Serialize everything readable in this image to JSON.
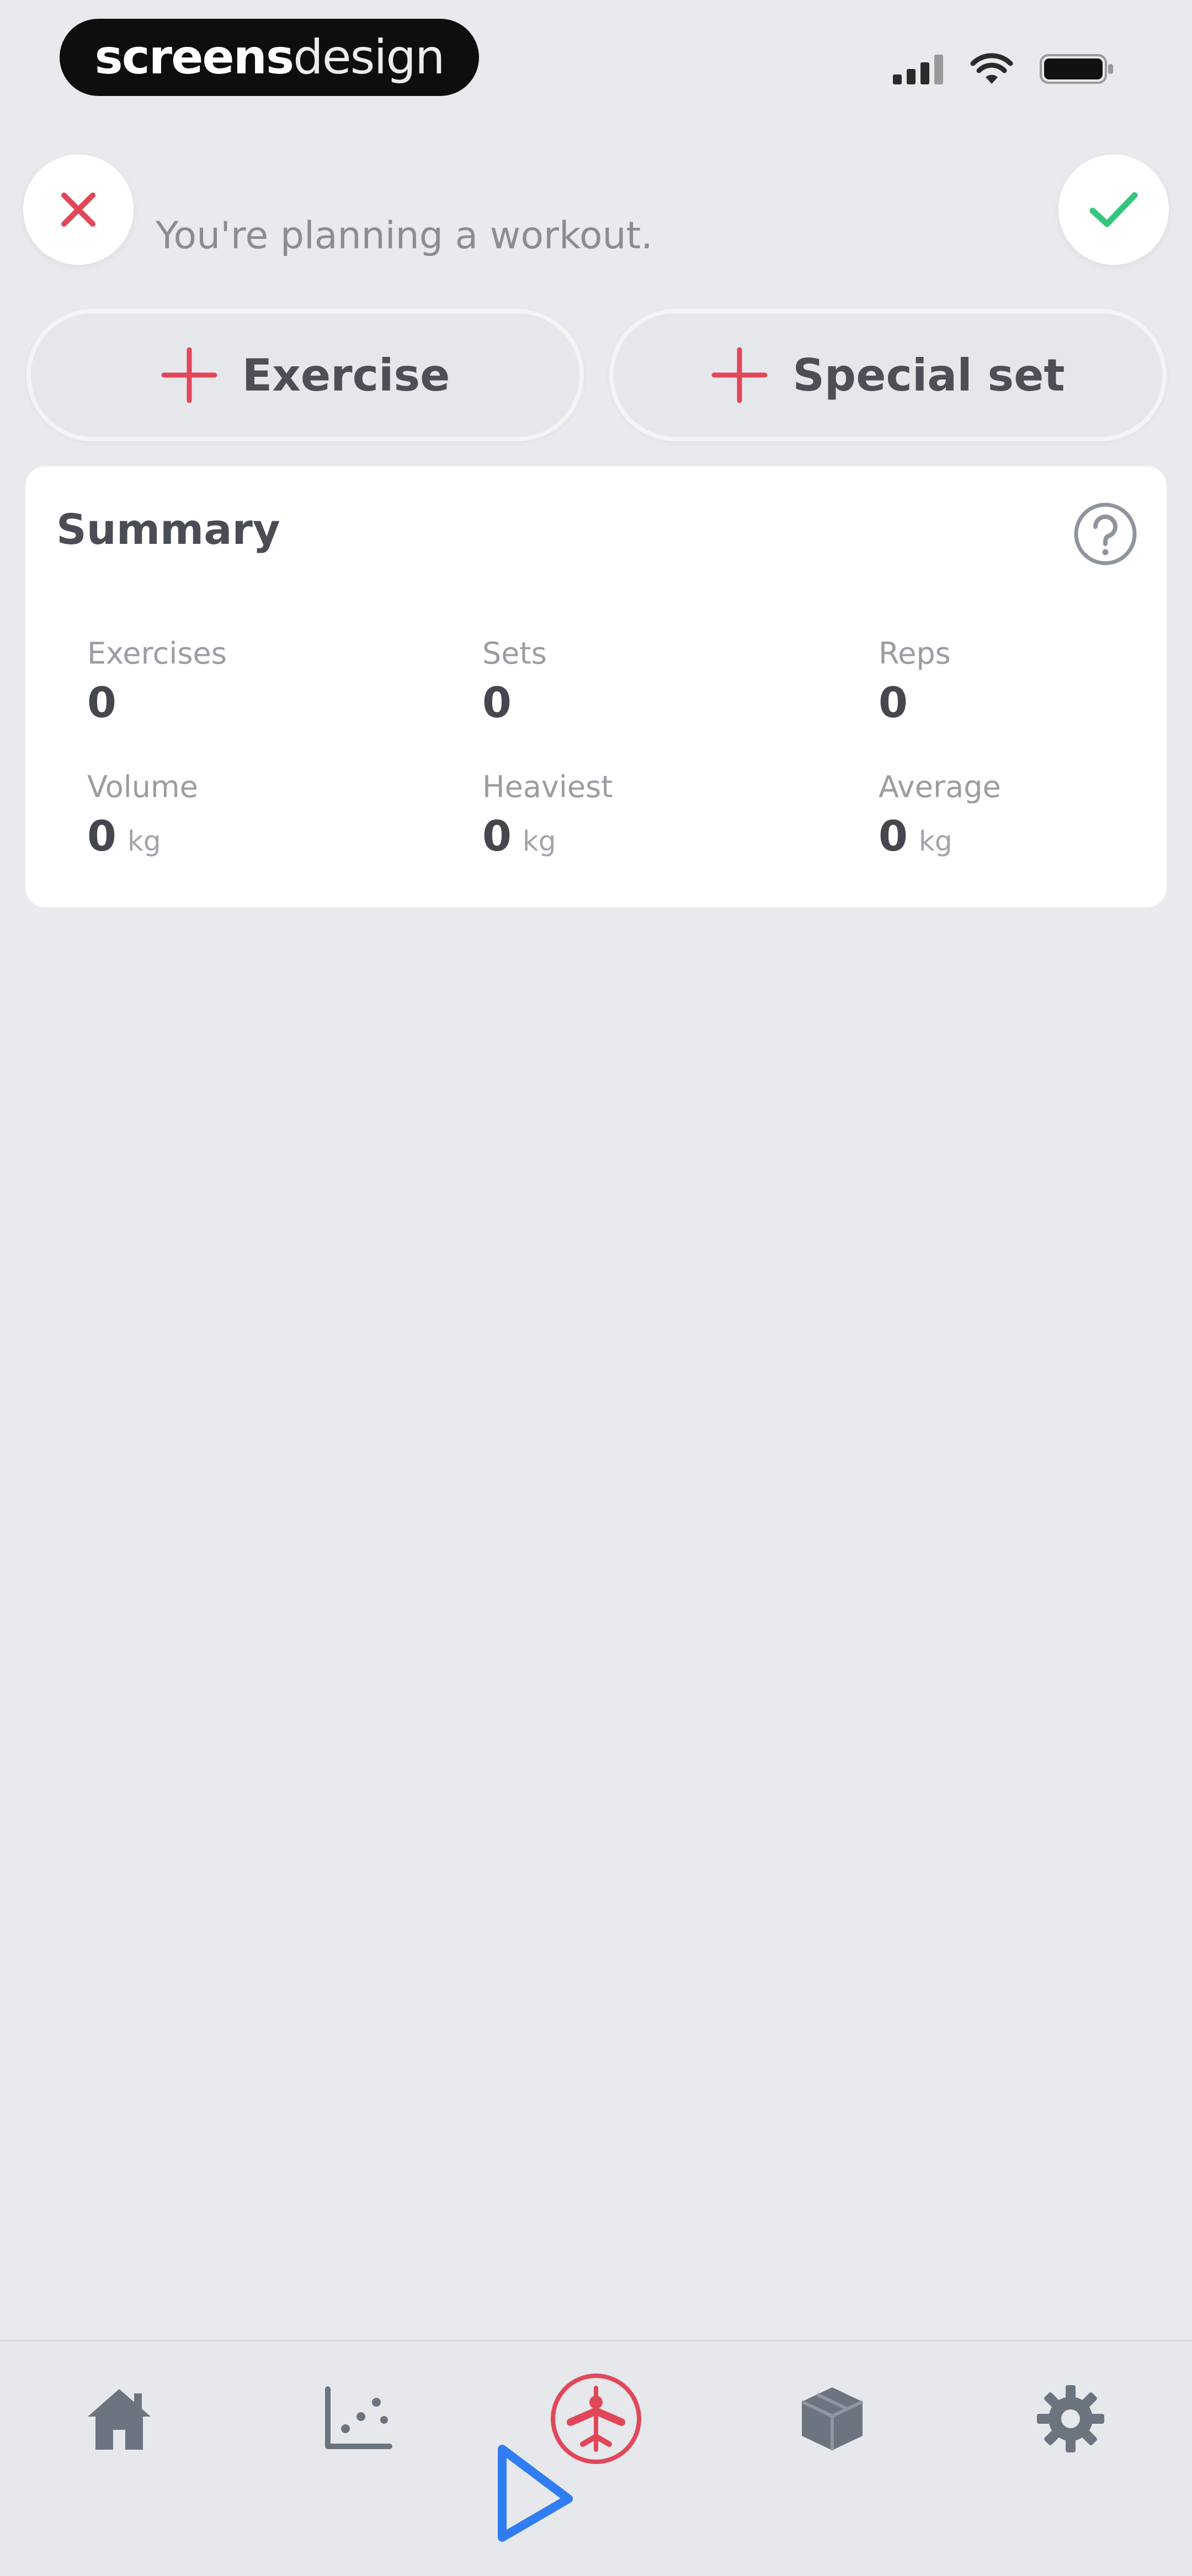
{
  "status_bar": {
    "brand_bold": "screens",
    "brand_light": "design"
  },
  "header": {
    "planning_text": "You're planning a workout."
  },
  "actions": {
    "add_exercise_label": "Exercise",
    "add_special_set_label": "Special set"
  },
  "summary": {
    "title": "Summary",
    "stats": [
      {
        "label": "Exercises",
        "value": "0",
        "unit": ""
      },
      {
        "label": "Sets",
        "value": "0",
        "unit": ""
      },
      {
        "label": "Reps",
        "value": "0",
        "unit": ""
      },
      {
        "label": "Volume",
        "value": "0",
        "unit": "kg"
      },
      {
        "label": "Heaviest",
        "value": "0",
        "unit": "kg"
      },
      {
        "label": "Average",
        "value": "0",
        "unit": "kg"
      }
    ]
  },
  "nav": {
    "items": [
      "home-icon",
      "stats-chart-icon",
      "workout-active-icon",
      "box-icon",
      "gear-icon"
    ],
    "active_index": 2
  },
  "colors": {
    "accent": "#e0485a",
    "confirm": "#34c77b",
    "nav_icon": "#6c7480",
    "background": "#e9eaee"
  }
}
